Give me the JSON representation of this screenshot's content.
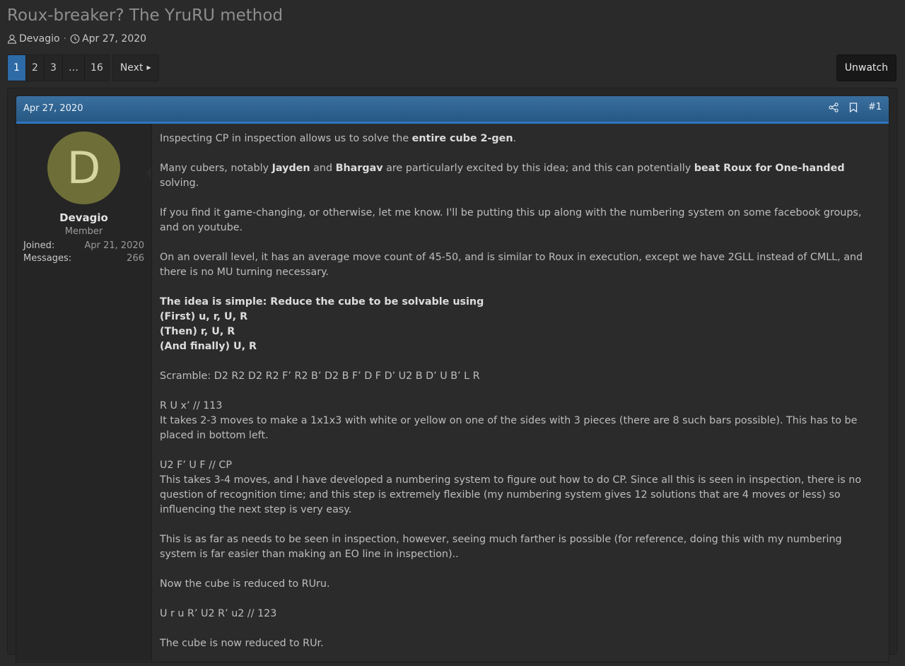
{
  "thread": {
    "title": "Roux-breaker? The YruRU method",
    "author": "Devagio",
    "meta_sep": "·",
    "date": "Apr 27, 2020"
  },
  "pagination": {
    "pages": [
      "1",
      "2",
      "3",
      "…",
      "16"
    ],
    "active_page": "1",
    "next_label": "Next"
  },
  "actions": {
    "unwatch_label": "Unwatch"
  },
  "post": {
    "date": "Apr 27, 2020",
    "number": "#1",
    "user": {
      "initial": "D",
      "avatar_color": "#6e6e38",
      "name": "Devagio",
      "role": "Member",
      "joined_label": "Joined:",
      "joined_value": "Apr 21, 2020",
      "messages_label": "Messages:",
      "messages_value": "266"
    },
    "p1": {
      "a": "Inspecting CP in inspection allows us to solve the ",
      "b": "entire cube 2-gen",
      "c": "."
    },
    "p2": {
      "a": "Many cubers, notably ",
      "b": "Jayden",
      "c": " and ",
      "d": "Bhargav",
      "e": " are particularly excited by this idea; and this can potentially ",
      "f": "beat Roux for One-handed",
      "g": " solving."
    },
    "p3": "If you find it game-changing, or otherwise, let me know. I'll be putting this up along with the numbering system on some facebook groups, and on youtube.",
    "p4": "On an overall level, it has an average move count of 45-50, and is similar to Roux in execution, except we have 2GLL instead of CMLL, and there is no MU turning necessary.",
    "idea": {
      "l1": "The idea is simple: Reduce the cube to be solvable using",
      "l2": "(First) u, r, U, R",
      "l3": "(Then) r, U, R",
      "l4": "(And finally) U, R"
    },
    "scramble": "Scramble: D2 R2 D2 R2 F’ R2 B’ D2 B F’ D F D’ U2 B D’ U B’ L R",
    "step1": {
      "moves": "R U x’ // 113",
      "text": "It takes 2-3 moves to make a 1x1x3 with white or yellow on one of the sides with 3 pieces (there are 8 such bars possible). This has to be placed in bottom left."
    },
    "step2": {
      "moves": "U2 F’ U F // CP",
      "text": "This takes 3-4 moves, and I have developed a numbering system to figure out how to do CP. Since all this is seen in inspection, there is no question of recognition time; and this step is extremely flexible (my numbering system gives 12 solutions that are 4 moves or less) so influencing the next step is very easy."
    },
    "p5": "This is as far as needs to be seen in inspection, however, seeing much farther is possible (for reference, doing this with my numbering system is far easier than making an EO line in inspection)..",
    "p6": "Now the cube is reduced to RUru.",
    "p7": "U r u R’ U2 R’ u2 // 123",
    "p8": "The cube is now reduced to RUr."
  }
}
